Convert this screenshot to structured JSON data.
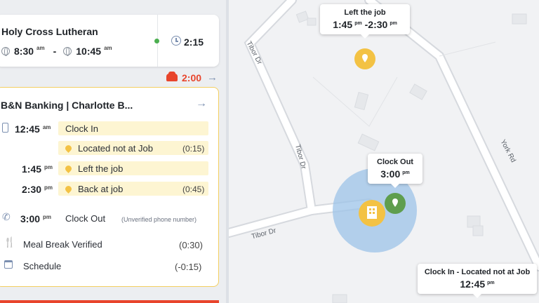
{
  "job1": {
    "title": "Holy Cross Lutheran",
    "start": "8:30",
    "start_sup": "am",
    "sep": "-",
    "end": "10:45",
    "end_sup": "am",
    "duration": "2:15"
  },
  "drive": {
    "time": "2:00"
  },
  "job2": {
    "title": "B&N Banking | Charlotte B...",
    "events": [
      {
        "time": "12:45",
        "sup": "am",
        "label": "Clock In"
      },
      {
        "time": "",
        "sup": "",
        "label": "Located not at Job",
        "dur": "(0:15)"
      },
      {
        "time": "1:45",
        "sup": "pm",
        "label": "Left the job"
      },
      {
        "time": "2:30",
        "sup": "pm",
        "label": "Back at job",
        "dur": "(0:45)"
      },
      {
        "time": "3:00",
        "sup": "pm",
        "label": "Clock Out",
        "note": "(Unverified phone number)"
      }
    ],
    "meal": {
      "label": "Meal Break Verified",
      "dur": "(0:30)"
    },
    "schedule": {
      "label": "Schedule",
      "dur": "(-0:15)"
    }
  },
  "map": {
    "roads": [
      "Tibor Dr",
      "Tibor Dr",
      "Tibor Dr",
      "York Rd"
    ],
    "tip_left": {
      "title": "Left the job",
      "t1": "1:45",
      "s1": "pm",
      "dash": "-",
      "t2": "2:30",
      "s2": "pm"
    },
    "tip_out": {
      "title": "Clock Out",
      "t": "3:00",
      "s": "pm"
    },
    "tip_in": {
      "title": "Clock In - Located not at Job",
      "t": "12:45",
      "s": "pm"
    }
  },
  "colors": {
    "accent": "#f3c244",
    "green": "#4caf50",
    "drive": "#e8452c",
    "geofence": "#9cc3e8"
  }
}
